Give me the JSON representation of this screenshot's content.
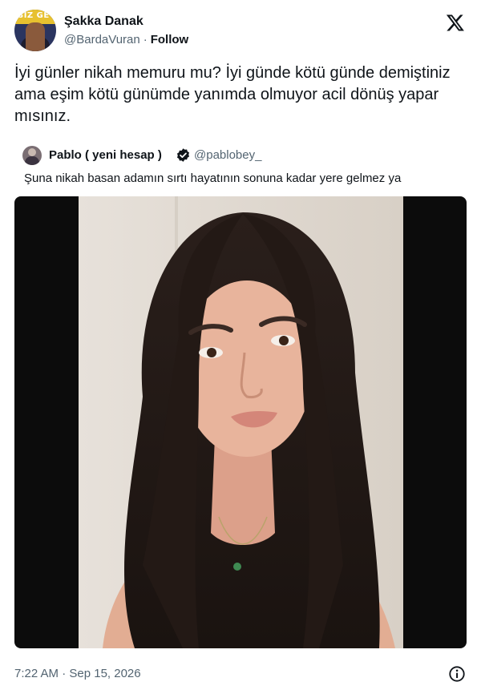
{
  "author": {
    "name": "Şakka Danak",
    "handle": "@BardaVuran",
    "follow_label": "Follow",
    "separator": "·",
    "avatar_text": "SİZ GE"
  },
  "tweet": {
    "text": "İyi günler nikah memuru mu? İyi günde kötü günde demiştiniz ama eşim kötü günümde yanımda olmuyor acil dönüş yapar mısınız."
  },
  "quoted": {
    "name": "Pablo ( yeni hesap )",
    "handle": "@pablobey_",
    "verified": true,
    "text": "Şuna nikah basan adamın sırtı hayatının sonuna kadar yere gelmez ya"
  },
  "meta": {
    "timestamp": "7:22 AM · Sep 15, 2026"
  },
  "icons": {
    "platform": "x-logo-icon",
    "info": "info-icon",
    "verified": "verified-badge-icon"
  },
  "colors": {
    "text": "#0f1419",
    "secondary": "#536471",
    "photo_letterbox": "#0c0c0c"
  }
}
